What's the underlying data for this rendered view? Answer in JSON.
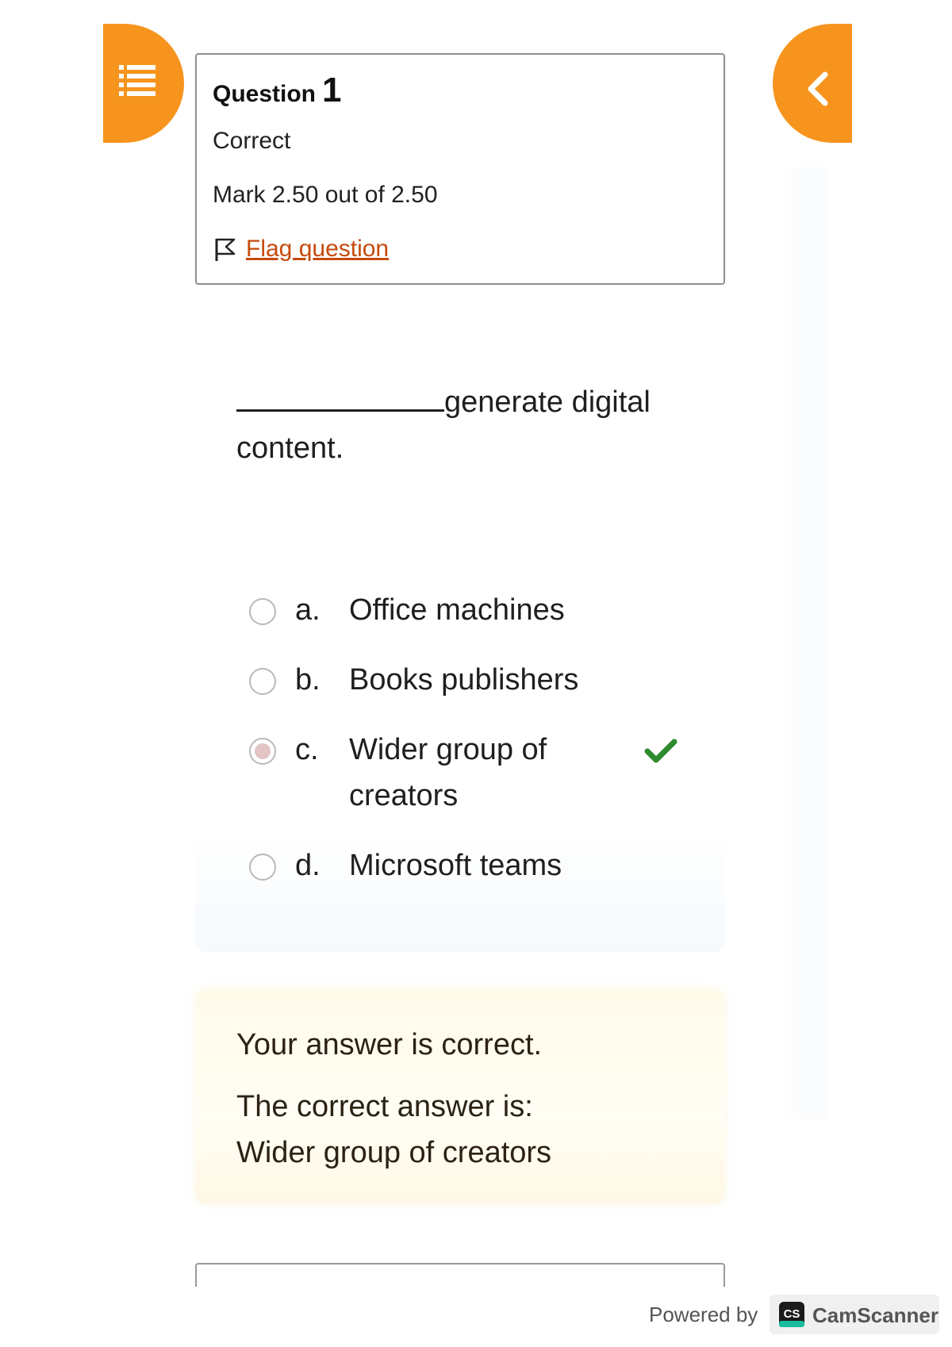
{
  "nav": {
    "drawer_icon": "list-icon",
    "back_icon": "chevron-left-icon",
    "accent_color": "#f7941d"
  },
  "question_info": {
    "heading_word": "Question",
    "number": "1",
    "state": "Correct",
    "grade": "Mark 2.50 out of 2.50",
    "flag_icon": "flag-icon",
    "flag_label": "Flag question",
    "flag_color": "#c64a0c"
  },
  "question": {
    "text": "generate digital content.",
    "options": [
      {
        "letter": "a.",
        "text": "Office machines",
        "checked": false,
        "correct": false
      },
      {
        "letter": "b.",
        "text": "Books publishers",
        "checked": false,
        "correct": false
      },
      {
        "letter": "c.",
        "text": "Wider group of creators",
        "checked": true,
        "correct": true
      },
      {
        "letter": "d.",
        "text": "Microsoft teams",
        "checked": false,
        "correct": false
      }
    ],
    "correct_mark_icon": "check-icon",
    "correct_mark_color": "#2e8b2e"
  },
  "feedback": {
    "result": "Your answer is correct.",
    "correct_intro": "The correct answer is:",
    "correct_answer": "Wider group of creators"
  },
  "watermark": {
    "powered_by": "Powered by",
    "brand_logo": "CS",
    "brand_name": "CamScanner"
  }
}
